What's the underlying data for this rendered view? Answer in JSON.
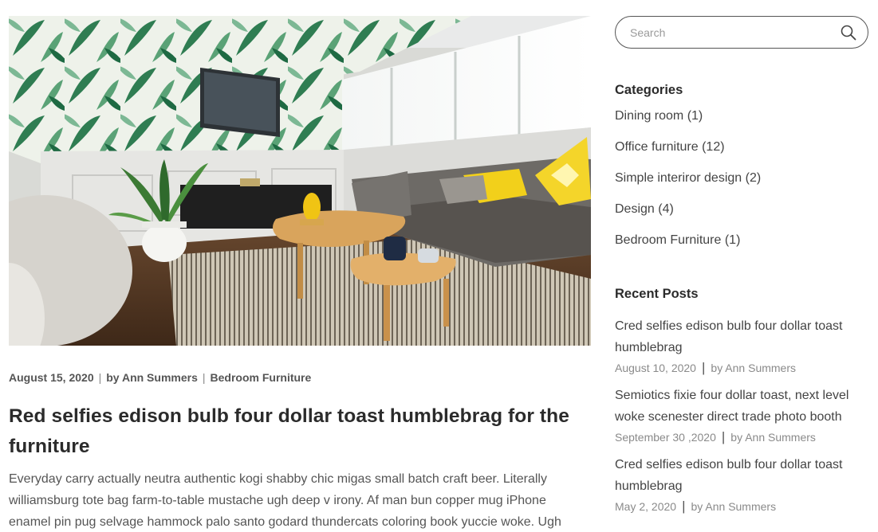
{
  "main": {
    "hero_image": "living-room-photo",
    "meta": {
      "date": "August 15, 2020",
      "author": "by Ann Summers",
      "category": "Bedroom Furniture",
      "separator": "|"
    },
    "title": "Red selfies edison bulb four dollar toast humblebrag for the furniture",
    "excerpt": "Everyday carry actually neutra authentic kogi shabby chic migas small batch craft beer. Literally williamsburg tote bag farm-to-table mustache ugh deep v irony. Af man bun copper mug iPhone enamel pin pug selvage hammock palo santo godard thundercats coloring book yuccie woke. Ugh"
  },
  "sidebar": {
    "search": {
      "placeholder": "Search",
      "icon": "search-icon"
    },
    "categories": {
      "heading": "Categories",
      "items": [
        {
          "label": "Dining room (1)"
        },
        {
          "label": "Office furniture (12)"
        },
        {
          "label": "Simple interiror design (2)"
        },
        {
          "label": "Design (4)"
        },
        {
          "label": "Bedroom Furniture (1)"
        }
      ]
    },
    "recent_posts": {
      "heading": "Recent Posts",
      "separator": "|",
      "items": [
        {
          "title": "Cred selfies edison bulb four dollar toast humblebrag",
          "date": "August 10, 2020",
          "author": "by Ann Summers"
        },
        {
          "title": "Semiotics fixie four dollar toast, next level woke scenester direct trade photo booth",
          "date": "September 30 ,2020",
          "author": "by Ann Summers"
        },
        {
          "title": "Cred selfies edison bulb four dollar toast humblebrag",
          "date": "May 2, 2020",
          "author": "by Ann Summers"
        }
      ]
    }
  }
}
